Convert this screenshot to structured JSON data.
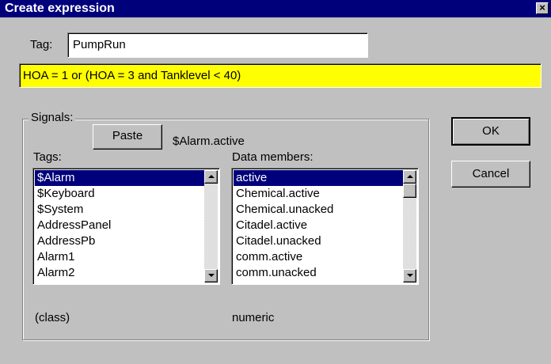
{
  "window": {
    "title": "Create expression",
    "close_glyph": "×"
  },
  "tag": {
    "label": "Tag:",
    "value": "PumpRun"
  },
  "expression": {
    "value": "HOA = 1 or (HOA = 3 and Tanklevel < 40)",
    "highlight_color": "#ffff00"
  },
  "signals": {
    "group_label": "Signals:",
    "paste_label": "Paste",
    "selected_signal": "$Alarm.active",
    "tags_label": "Tags:",
    "data_members_label": "Data members:",
    "tags_list": [
      "$Alarm",
      "$Keyboard",
      "$System",
      "AddressPanel",
      "AddressPb",
      "Alarm1",
      "Alarm2"
    ],
    "tags_selected": "$Alarm",
    "data_members_list": [
      "active",
      "Chemical.active",
      "Chemical.unacked",
      "Citadel.active",
      "Citadel.unacked",
      "comm.active",
      "comm.unacked"
    ],
    "data_members_selected": "active",
    "tag_type": "(class)",
    "member_type": "numeric"
  },
  "buttons": {
    "ok": "OK",
    "cancel": "Cancel"
  },
  "colors": {
    "titlebar": "#00007b",
    "selection": "#00007b",
    "face": "#c0c0c0"
  }
}
